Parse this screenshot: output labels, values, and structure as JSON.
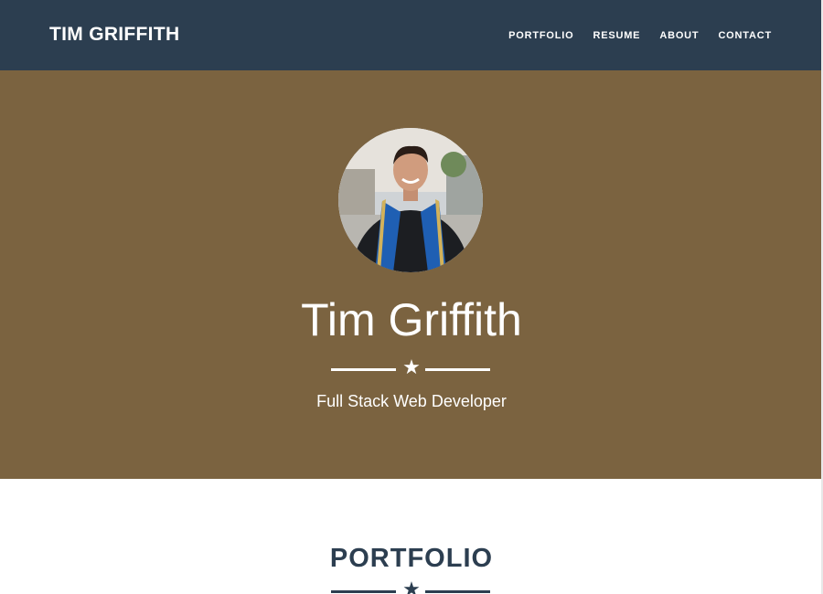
{
  "navbar": {
    "brand": "TIM GRIFFITH",
    "links": [
      {
        "label": "PORTFOLIO"
      },
      {
        "label": "RESUME"
      },
      {
        "label": "ABOUT"
      },
      {
        "label": "CONTACT"
      }
    ]
  },
  "hero": {
    "name": "Tim Griffith",
    "divider_icon": "star-icon",
    "subtitle": "Full Stack Web Developer"
  },
  "portfolio": {
    "heading": "PORTFOLIO",
    "divider_icon": "star-icon"
  },
  "colors": {
    "navbar_bg": "#2c3e50",
    "hero_bg": "#7b6340",
    "hero_text": "#ffffff",
    "heading_text": "#2c3e50",
    "page_bg": "#ffffff"
  }
}
